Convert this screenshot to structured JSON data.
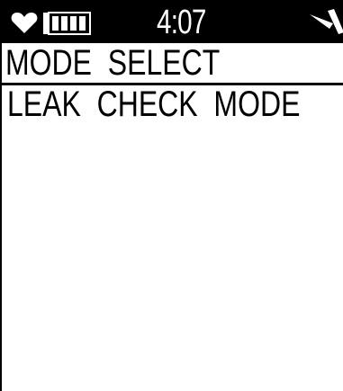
{
  "status_bar": {
    "time": "4:07",
    "icons": [
      "heart-icon",
      "battery-icon",
      "signal-icon"
    ]
  },
  "screen": {
    "title": "MODE  SELECT",
    "selected_mode": "LEAK  CHECK  MODE"
  },
  "colors": {
    "foreground": "#000000",
    "background": "#ffffff"
  }
}
